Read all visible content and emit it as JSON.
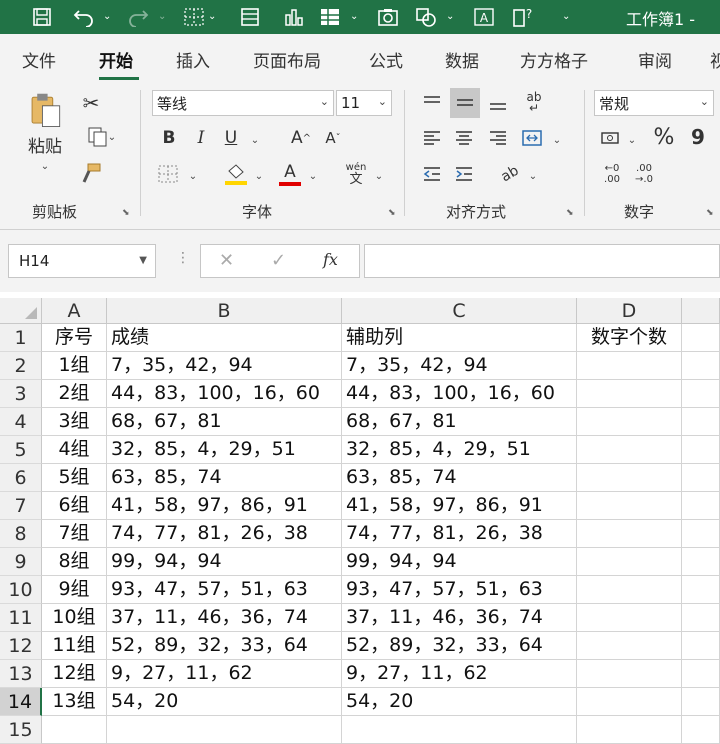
{
  "titlebar": {
    "title": "工作簿1 -",
    "icons": [
      "save-icon",
      "undo-icon",
      "redo-icon",
      "borders-icon",
      "form-icon",
      "chart-icon",
      "table-icon",
      "camera-icon",
      "shapes-icon",
      "text-box-icon",
      "help-icon"
    ]
  },
  "tabs": [
    "文件",
    "开始",
    "插入",
    "页面布局",
    "公式",
    "数据",
    "方方格子",
    "审阅",
    "视"
  ],
  "active_tab": "开始",
  "ribbon": {
    "clipboard": {
      "paste_label": "粘贴",
      "group_label": "剪贴板"
    },
    "font": {
      "font_name": "等线",
      "font_size": "11",
      "bold": "B",
      "italic": "I",
      "underline": "U",
      "grow": "A",
      "shrink": "A",
      "font_color_letter": "A",
      "phonetic_top": "wén",
      "phonetic_bottom": "文",
      "group_label": "字体"
    },
    "alignment": {
      "group_label": "对齐方式"
    },
    "number": {
      "format": "常规",
      "percent": "%",
      "comma": "9",
      "inc_top": "←0",
      "inc_bottom": ".00",
      "dec_top": ".00",
      "dec_bottom": "→.0",
      "group_label": "数字"
    },
    "colors": {
      "fill_yellow": "#ffd500",
      "font_red": "#e00000",
      "accent": "#217346"
    }
  },
  "formula_bar": {
    "name_box": "H14",
    "cancel": "✕",
    "enter": "✓",
    "fx": "fx",
    "formula": ""
  },
  "sheet": {
    "columns": [
      "A",
      "B",
      "C",
      "D"
    ],
    "row_numbers": [
      "1",
      "2",
      "3",
      "4",
      "5",
      "6",
      "7",
      "8",
      "9",
      "10",
      "11",
      "12",
      "13",
      "14",
      "15"
    ],
    "selected_row": "14",
    "headers": [
      "序号",
      "成绩",
      "辅助列",
      "数字个数"
    ],
    "rows": [
      [
        "1组",
        "7，35，42，94",
        "7，35，42，94",
        ""
      ],
      [
        "2组",
        "44，83，100，16，60",
        "44，83，100，16，60",
        ""
      ],
      [
        "3组",
        "68，67，81",
        "68，67，81",
        ""
      ],
      [
        "4组",
        "32，85，4，29，51",
        "32，85，4，29，51",
        ""
      ],
      [
        "5组",
        "63，85，74",
        "63，85，74",
        ""
      ],
      [
        "6组",
        "41，58，97，86，91",
        "41，58，97，86，91",
        ""
      ],
      [
        "7组",
        "74，77，81，26，38",
        "74，77，81，26，38",
        ""
      ],
      [
        "8组",
        "99，94，94",
        "99，94，94",
        ""
      ],
      [
        "9组",
        "93，47，57，51，63",
        "93，47，57，51，63",
        ""
      ],
      [
        "10组",
        "37，11，46，36，74",
        "37，11，46，36，74",
        ""
      ],
      [
        "11组",
        "52，89，32，33，64",
        "52，89，32，33，64",
        ""
      ],
      [
        "12组",
        "9，27，11，62",
        "9，27，11，62",
        ""
      ],
      [
        "13组",
        "54，20",
        "54，20",
        ""
      ]
    ]
  }
}
